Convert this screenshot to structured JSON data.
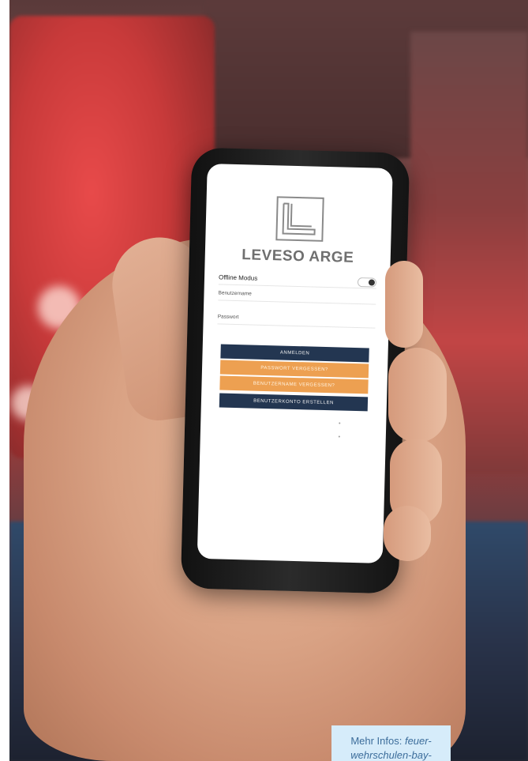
{
  "app": {
    "logo_text": "LEVESO ARGE",
    "offline_label": "Offline Modus",
    "username_placeholder": "Benutzername",
    "password_placeholder": "Passwort",
    "buttons": [
      {
        "label": "ANMELDEN",
        "color": "#233651"
      },
      {
        "label": "PASSWORT VERGESSEN?",
        "color": "#eda051"
      },
      {
        "label": "BENUTZERNAME VERGESSEN?",
        "color": "#eda051"
      },
      {
        "label": "BENUTZERKONTO ERSTELLEN",
        "color": "#233651"
      }
    ]
  },
  "caption": {
    "prefix": "Mehr Infos: ",
    "link_text": "feuer-wehrschulen-bay-"
  },
  "colors": {
    "caption_bg": "#d6ecfa",
    "caption_text": "#3c6d9b"
  }
}
